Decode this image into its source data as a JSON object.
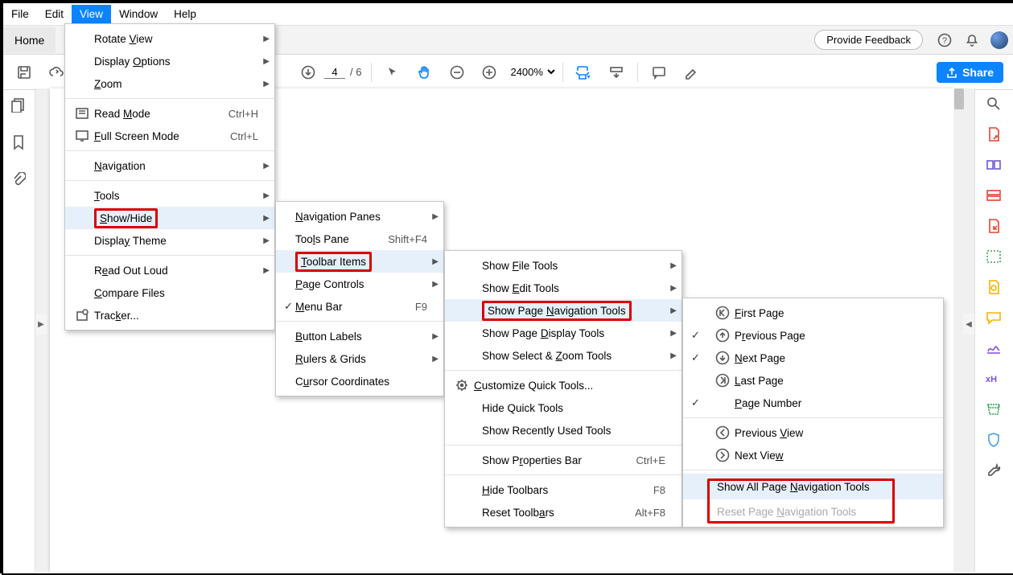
{
  "menubar": {
    "file": "File",
    "edit": "Edit",
    "view": "View",
    "window": "Window",
    "help": "Help"
  },
  "homebar": {
    "home": "Home",
    "feedback": "Provide Feedback"
  },
  "toolbar": {
    "page": "4",
    "pages": "/  6",
    "zoom": "2400%",
    "share": "Share"
  },
  "viewMenu": {
    "rotate": "Rotate View",
    "display": "Display Options",
    "zoom": "Zoom",
    "read": "Read Mode",
    "readKey": "Ctrl+H",
    "full": "Full Screen Mode",
    "fullKey": "Ctrl+L",
    "nav": "Navigation",
    "tools": "Tools",
    "showhide": "Show/Hide",
    "theme": "Display Theme",
    "readout": "Read Out Loud",
    "compare": "Compare Files",
    "tracker": "Tracker..."
  },
  "showHideMenu": {
    "navpanes": "Navigation Panes",
    "toolspane": "Tools Pane",
    "toolspaneKey": "Shift+F4",
    "toolbaritems": "Toolbar Items",
    "pagecontrols": "Page Controls",
    "menubar": "Menu Bar",
    "menubarKey": "F9",
    "btnlabels": "Button Labels",
    "rulers": "Rulers & Grids",
    "cursor": "Cursor Coordinates"
  },
  "toolbarItemsMenu": {
    "file": "Show File Tools",
    "edit": "Show Edit Tools",
    "nav": "Show Page Navigation Tools",
    "display": "Show Page Display Tools",
    "zoom": "Show Select & Zoom Tools",
    "custom": "Customize Quick Tools...",
    "hideq": "Hide Quick Tools",
    "recent": "Show Recently Used Tools",
    "props": "Show Properties Bar",
    "propsKey": "Ctrl+E",
    "hidetb": "Hide Toolbars",
    "hidetbKey": "F8",
    "reset": "Reset Toolbars",
    "resetKey": "Alt+F8"
  },
  "navToolsMenu": {
    "first": "First Page",
    "prev": "Previous Page",
    "next": "Next Page",
    "last": "Last Page",
    "pagenum": "Page Number",
    "prevview": "Previous View",
    "nextview": "Next View",
    "showall": "Show All Page Navigation Tools",
    "resetnav": "Reset Page Navigation Tools"
  }
}
